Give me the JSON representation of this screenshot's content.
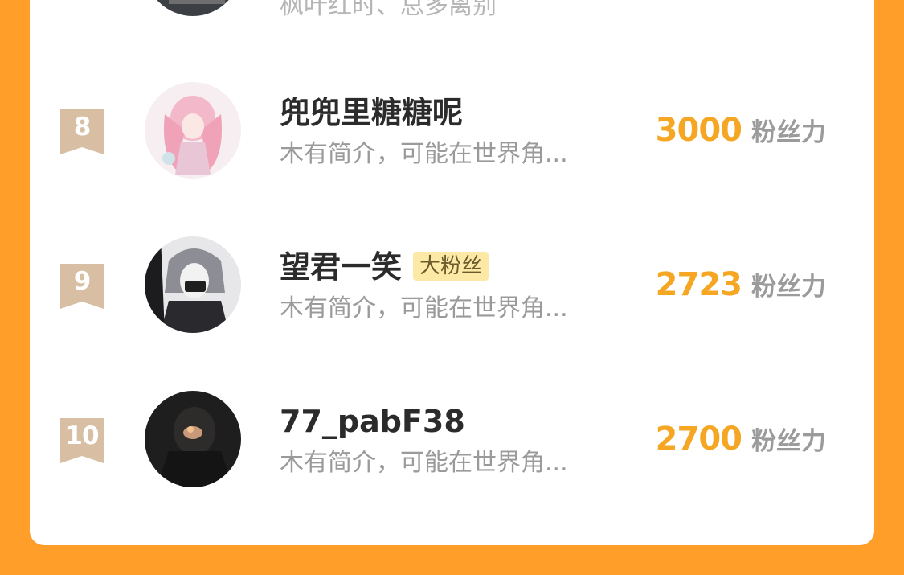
{
  "previous_row": {
    "bio": "枫叶红时、总多离别"
  },
  "rows": [
    {
      "rank": "8",
      "name": "兜兜里糖糖呢",
      "badge": "",
      "bio": "木有简介，可能在世界角...",
      "score": "3000",
      "score_unit": "粉丝力"
    },
    {
      "rank": "9",
      "name": "望君一笑",
      "badge": "大粉丝",
      "bio": "木有简介，可能在世界角...",
      "score": "2723",
      "score_unit": "粉丝力"
    },
    {
      "rank": "10",
      "name": "77_pabF38",
      "badge": "",
      "bio": "木有简介，可能在世界角...",
      "score": "2700",
      "score_unit": "粉丝力"
    }
  ],
  "colors": {
    "background": "#FF9F2A",
    "score": "#F5A623",
    "rank_ribbon": "#D8BFA4",
    "badge_bg": "#FCE9A6"
  }
}
